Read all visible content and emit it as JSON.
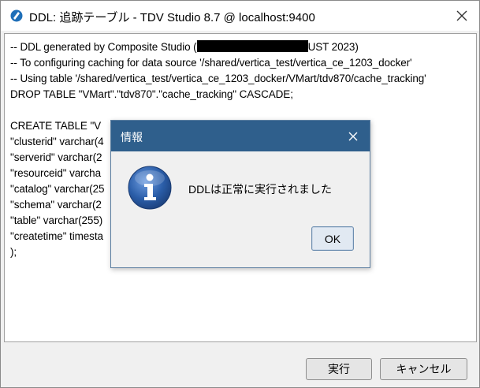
{
  "window": {
    "title": "DDL: 追跡テーブル - TDV Studio 8.7 @ localhost:9400"
  },
  "editor": {
    "lines": [
      {
        "text": "-- DDL generated by Composite Studio ("
      },
      {
        "text": "-- To configuring caching for data source '/shared/vertica_test/vertica_ce_1203_docker'"
      },
      {
        "text": "-- Using table '/shared/vertica_test/vertica_ce_1203_docker/VMart/tdv870/cache_tracking'"
      },
      {
        "text": "DROP TABLE \"VMart\".\"tdv870\".\"cache_tracking\" CASCADE;"
      },
      {
        "text": ""
      },
      {
        "text": "CREATE TABLE \"V"
      },
      {
        "text": "\"clusterid\" varchar(4"
      },
      {
        "text": "\"serverid\" varchar(2"
      },
      {
        "text": "\"resourceid\" varcha"
      },
      {
        "text": "\"catalog\" varchar(25"
      },
      {
        "text": "\"schema\" varchar(2"
      },
      {
        "text": "\"table\" varchar(255)"
      },
      {
        "text": "\"createtime\" timesta"
      },
      {
        "text": ");"
      }
    ],
    "line1_suffix": "UST 2023)"
  },
  "buttons": {
    "execute": "実行",
    "cancel": "キャンセル"
  },
  "dialog": {
    "title": "情報",
    "message": "DDLは正常に実行されました",
    "ok": "OK"
  },
  "colors": {
    "dialog_title_bg": "#2f5f8c",
    "info_icon_blue": "#2a5da8"
  }
}
